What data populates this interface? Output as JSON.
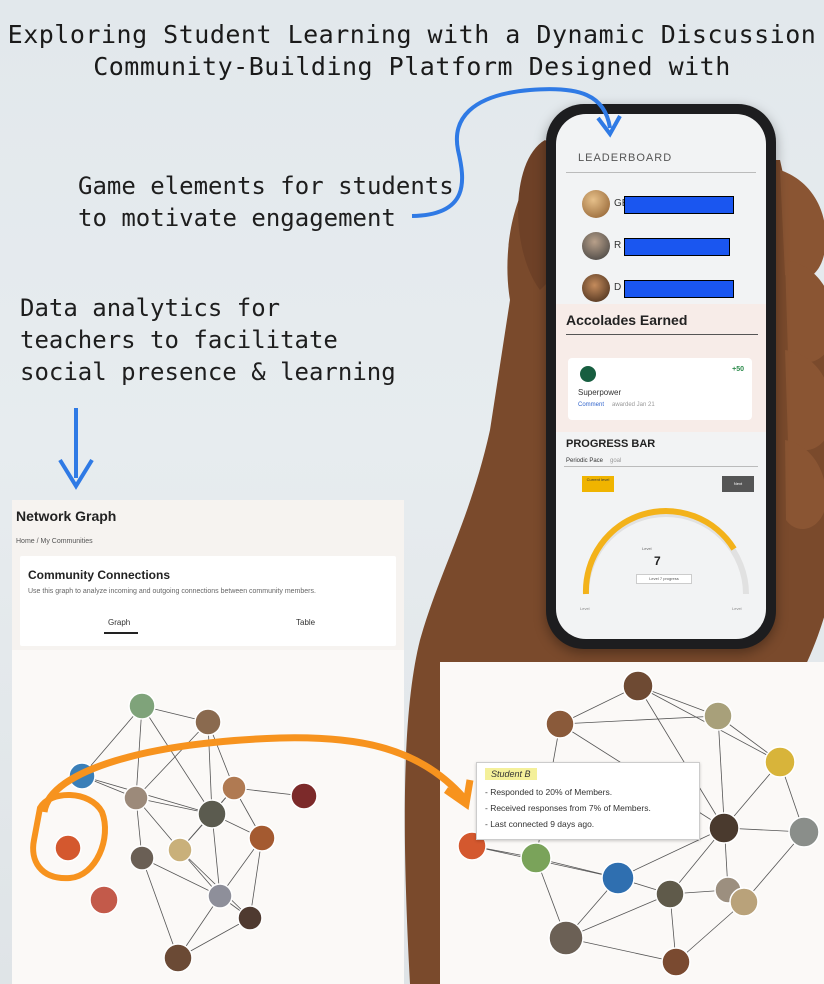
{
  "page_title_fragment": "",
  "title_line1": "Exploring Student Learning with a Dynamic Discussion",
  "title_line2": "Community-Building Platform Designed with",
  "caption_game": [
    "Game elements for students",
    "to motivate engagement"
  ],
  "caption_data": [
    "Data analytics for",
    "teachers to facilitate",
    "social presence & learning"
  ],
  "phone": {
    "leaderboard_title": "LEADERBOARD",
    "leaders": [
      {
        "initial": "GE"
      },
      {
        "initial": "R"
      },
      {
        "initial": "D"
      }
    ],
    "accolades_title": "Accolades Earned",
    "accolade": {
      "name": "Superpower",
      "points": "+50",
      "link": "Comment",
      "date": "awarded Jan 21"
    },
    "progress_title": "PROGRESS BAR",
    "progress_label": "Periodic Pace",
    "progress_sub": "goal",
    "btn_left": "Current level",
    "btn_right": "Next",
    "gauge_label": "Level",
    "gauge_value": "7",
    "gauge_pill": "Level 7 progress",
    "gauge_min": "Level",
    "gauge_max": "Level",
    "colors": {
      "gauge": "#f3b21a",
      "bar": "#1a56f0"
    }
  },
  "network": {
    "title": "Network Graph",
    "breadcrumb": "Home  /  My Communities",
    "card_title": "Community Connections",
    "card_desc": "Use this graph to analyze incoming and outgoing connections between community members.",
    "tabs": [
      "Graph",
      "Table"
    ],
    "active_tab": "Graph"
  },
  "tooltip": {
    "name": "Student B",
    "lines": [
      "- Responded to 20% of Members.",
      "- Received responses from 7% of Members.",
      "- Last connected 9 days ago."
    ]
  },
  "colors": {
    "highlight": "#f7931e",
    "arrow": "#2f7ae5"
  }
}
